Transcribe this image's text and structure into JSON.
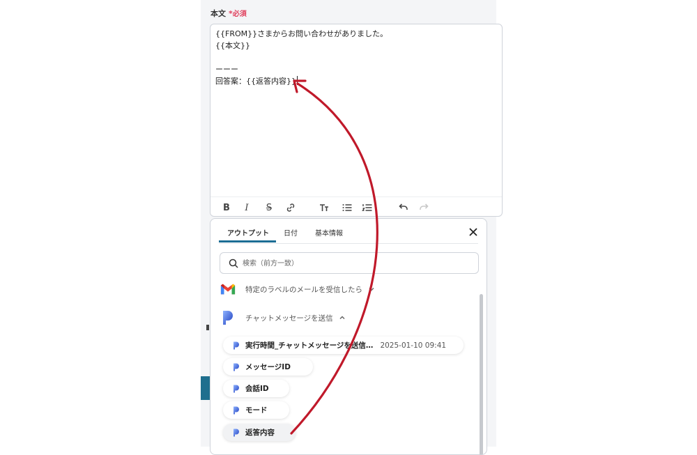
{
  "field": {
    "label": "本文",
    "required_mark": "*",
    "required_text": "必須"
  },
  "editor": {
    "lines": [
      "{{FROM}}さまからお問い合わせがありました。",
      "{{本文}}",
      "",
      "ーーー",
      "回答案：{{返答内容}}"
    ]
  },
  "toolbar": {
    "buttons": [
      "bold-icon",
      "italic-icon",
      "strikethrough-icon",
      "link-icon",
      "font-size-icon",
      "bulleted-list-icon",
      "numbered-list-icon",
      "undo-icon",
      "redo-icon"
    ],
    "bold_glyph": "B",
    "italic_glyph": "I",
    "strike_glyph": "S"
  },
  "panel": {
    "tabs": [
      {
        "label": "アウトプット",
        "active": true
      },
      {
        "label": "日付",
        "active": false
      },
      {
        "label": "基本情報",
        "active": false
      }
    ],
    "search_placeholder": "検索（前方一致）",
    "apps": [
      {
        "label": "特定のラベルのメールを受信したら",
        "icon": "gmail-icon",
        "expanded": false
      },
      {
        "label": "チャットメッセージを送信",
        "icon": "dify-icon",
        "expanded": true
      }
    ],
    "outputs": [
      {
        "label": "実行時間_チャットメッセージを送信…",
        "value": "2025-01-10 09:41"
      },
      {
        "label": "メッセージID",
        "value": ""
      },
      {
        "label": "会話ID",
        "value": ""
      },
      {
        "label": "モード",
        "value": ""
      },
      {
        "label": "返答内容",
        "value": ""
      }
    ]
  },
  "colors": {
    "accent": "#1c6d94",
    "required": "#e0415e",
    "arrow": "#c0192a"
  }
}
